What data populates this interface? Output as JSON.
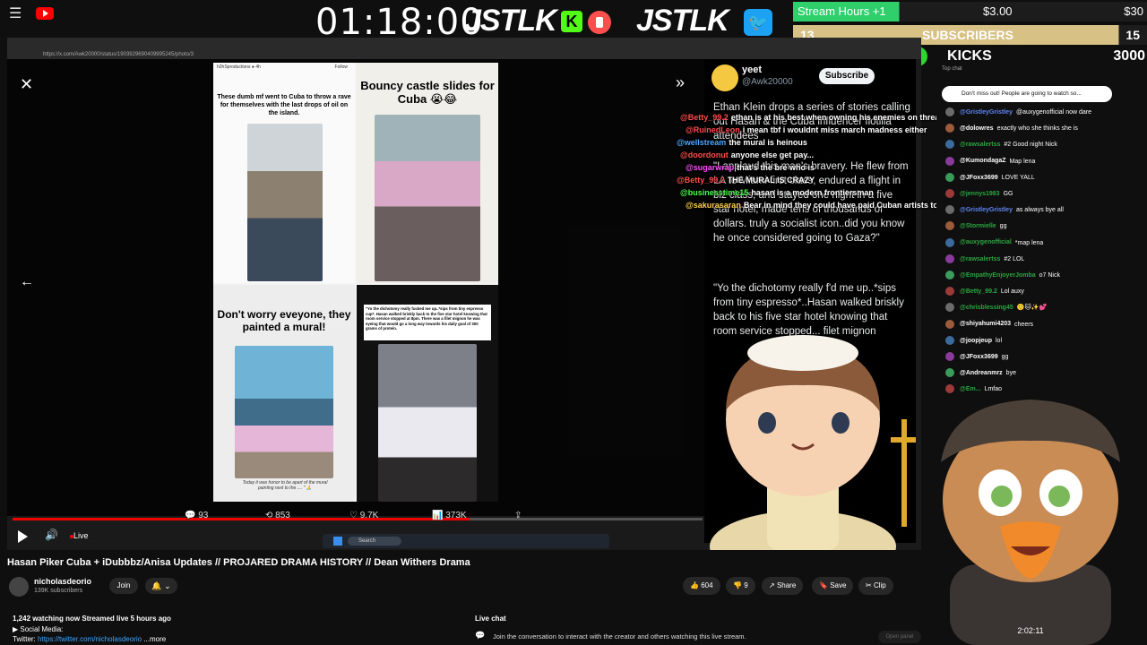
{
  "overlay": {
    "clock": "01:18:00",
    "brand_left": "JSTLK",
    "brand_right": "JSTLK",
    "brand_k": "K",
    "goal1_label": "Stream Hours +1",
    "goal1_current": "$3.00",
    "goal1_target": "$30",
    "goal2_count": "13",
    "goal2_label": "SUBSCRIBERS",
    "goal2_target": "15",
    "kicks_current": "1000",
    "kicks_label": "KICKS",
    "kicks_target": "3000"
  },
  "browser": {
    "url": "https://x.com/Awk20000/status/1903929690409995245/photo/3"
  },
  "collage": {
    "tile1_header": "h2hSproductions ● 4h",
    "tile1_caption": "These dumb mf went to Cuba to throw a rave for themselves with the last drops of oil on the island.",
    "tile2_caption": "Bouncy castle slides for Cuba 😭😂",
    "tile3_caption": "Don't worry eveyone, they painted a mural!",
    "tile4_caption": "\"Yo the dichotomy really fucked me up..*sips from tiny espresso cup*. Hasan walked briskly back to the five star hotel knowing that room service stopped at 8pm. There was a filet mignon he was eyeing that would go a long way towards his daily goal of 300 grams of protein.",
    "tile3_footer": "Today it was honor to be apart of the mural painting next to the .... \" 🙏",
    "follow": "Follow"
  },
  "tweet": {
    "name": "yeet",
    "handle": "@Awk20000",
    "subscribe": "Subscribe",
    "body1": "Ethan Klein drops a series of stories calling out Hasan & the Cuba influencer flotilla attendees",
    "body2": "\"I applaud this man's bravery. He flew from LA to Miami first class, endured a flight in biz class, and stayed one night in a five star hotel, made tens of thousands of dollars. truly a socialist icon..did you know he once considered going to Gaza?\"",
    "body3": "\"Yo the dichotomy really f'd me up..*sips from tiny espresso*..Hasan walked briskly back to his five star hotel knowing that room service stopped... filet mignon"
  },
  "video_chat": [
    {
      "user": "@Betty_99.2",
      "color": "#ff4d4d",
      "text": "ethan is at his best when owning his enemies on threads"
    },
    {
      "user": "@RuinedLeon",
      "color": "#ff4d4d",
      "text": "i mean tbf i wouldnt miss march madness either"
    },
    {
      "user": "@wellstream",
      "color": "#4da6ff",
      "text": "the mural is heinous"
    },
    {
      "user": "@doordonut",
      "color": "#ff4d4d",
      "text": "anyone else get pay..."
    },
    {
      "user": "@sugarwrap",
      "color": "#ff4dff",
      "text": "that's the bre who is"
    },
    {
      "user": "@Betty_99.2",
      "color": "#ff4d4d",
      "text": "THE MURAL IS CRAZY"
    },
    {
      "user": "@businesstime15",
      "color": "#4dff4d",
      "text": "hasan is a modern frontiersman"
    },
    {
      "user": "@sakurasaran",
      "color": "#ffcc4d",
      "text": "Bear in mind they could have paid Cuban artists to do this instead"
    }
  ],
  "player": {
    "replies": "93",
    "reposts": "853",
    "likes": "9.7K",
    "views": "373K",
    "live": "Live",
    "taskbar_search": "Search"
  },
  "chat": {
    "notice": "Don't miss out! People are going to watch so...",
    "top_chat": "Top chat",
    "messages": [
      {
        "user": "@GristleyGristley",
        "color": "#5e84f1",
        "text": "@auxygenofficial now dare"
      },
      {
        "user": "@dolowres",
        "color": "#ffffff",
        "text": "exactly who she thinks she is"
      },
      {
        "user": "@rawsalertss",
        "color": "#2ba640",
        "text": "#2  Good night Nick"
      },
      {
        "user": "@KumondagaZ",
        "color": "#ffffff",
        "text": "Map lena"
      },
      {
        "user": "@JFoxx3699",
        "color": "#ffffff",
        "text": "LOVE YALL"
      },
      {
        "user": "@jennys1983",
        "color": "#2ba640",
        "text": "GG"
      },
      {
        "user": "@GristleyGristley",
        "color": "#5e84f1",
        "text": "as always bye all"
      },
      {
        "user": "@Stormielle",
        "color": "#2ba640",
        "text": "gg"
      },
      {
        "user": "@auxygenofficial",
        "color": "#2ba640",
        "text": "*map lena"
      },
      {
        "user": "@rawsalertss",
        "color": "#2ba640",
        "text": "#2  LOL"
      },
      {
        "user": "@EmpathyEnjoyerJomba",
        "color": "#2ba640",
        "text": "o7 Nick"
      },
      {
        "user": "@Betty_99.2",
        "color": "#2ba640",
        "text": "Lol auxy"
      },
      {
        "user": "@chrisblessing45",
        "color": "#2ba640",
        "text": "🙂🐱✨💕"
      },
      {
        "user": "@shiyahumi4203",
        "color": "#ffffff",
        "text": "cheers"
      },
      {
        "user": "@joopjeup",
        "color": "#ffffff",
        "text": "lol"
      },
      {
        "user": "@JFoxx3699",
        "color": "#ffffff",
        "text": "gg"
      },
      {
        "user": "@Andreanmrz",
        "color": "#ffffff",
        "text": "bye"
      },
      {
        "user": "@Em...",
        "color": "#2ba640",
        "text": "Lmfao"
      }
    ],
    "timestamp": "2:02:11"
  },
  "video": {
    "title": "Hasan Piker Cuba + iDubbbz/Anisa Updates // PROJARED DRAMA HISTORY // Dean Withers Drama",
    "channel": "nicholasdeorio",
    "subs": "139K subscribers",
    "join": "Join",
    "likes": "604",
    "dislikes": "9",
    "share": "Share",
    "save": "Save",
    "clip": "Clip",
    "watching": "1,242 watching now  Streamed live 5 hours ago",
    "desc_social": "▶ Social Media:",
    "desc_twitter_label": "Twitter: ",
    "desc_twitter_link": "https://twitter.com/nicholasdeorio",
    "desc_more": "...more",
    "livechat_title": "Live chat",
    "livechat_msg": "Join the conversation to interact with the creator and others watching this live stream.",
    "open_panel": "Open panel"
  },
  "colors": {
    "accent_red": "#ff0000",
    "kick_green": "#53fc18",
    "yt_blue": "#3ea6ff"
  }
}
